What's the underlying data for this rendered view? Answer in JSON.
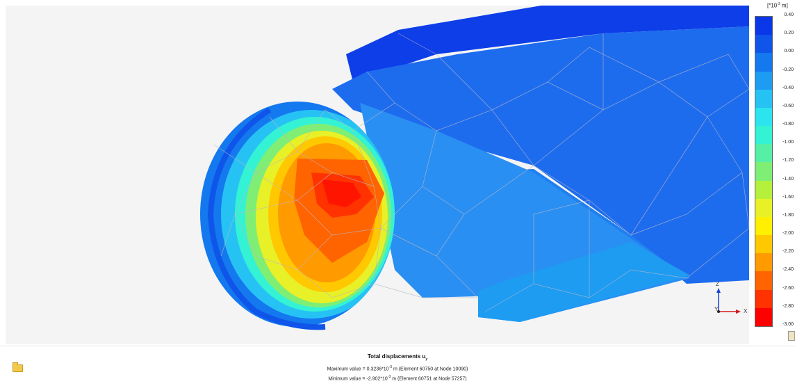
{
  "legend": {
    "unit_prefix": "[*10",
    "unit_exp": "-3",
    "unit_suffix": " m]",
    "ticks": [
      "0.40",
      "0.20",
      "0.00",
      "-0.20",
      "-0.40",
      "-0.60",
      "-0.80",
      "-1.00",
      "-1.20",
      "-1.40",
      "-1.60",
      "-1.80",
      "-2.00",
      "-2.20",
      "-2.40",
      "-2.60",
      "-2.80",
      "-3.00"
    ],
    "colors": [
      "#0014e6",
      "#0a37e8",
      "#0f55ea",
      "#1478ef",
      "#1d9cf2",
      "#27c2f4",
      "#2be4ee",
      "#34f2d4",
      "#55f0a6",
      "#7fee74",
      "#b4f03c",
      "#e8f028",
      "#fff000",
      "#ffc800",
      "#ff9a00",
      "#ff6400",
      "#ff3200",
      "#ff0000"
    ]
  },
  "axes": {
    "z": "Z",
    "y": "Y",
    "x": "X"
  },
  "info": {
    "title_main": "Total displacements u",
    "title_sub": "y",
    "max_prefix": "Maximum value = 0.3236*10",
    "max_exp": "-3",
    "max_suffix": " m (Element 60750 at Node 10090)",
    "min_prefix": "Minimum value = -2.902*10",
    "min_exp": "-3",
    "min_suffix": " m (Element 60751 at Node 57257)"
  }
}
